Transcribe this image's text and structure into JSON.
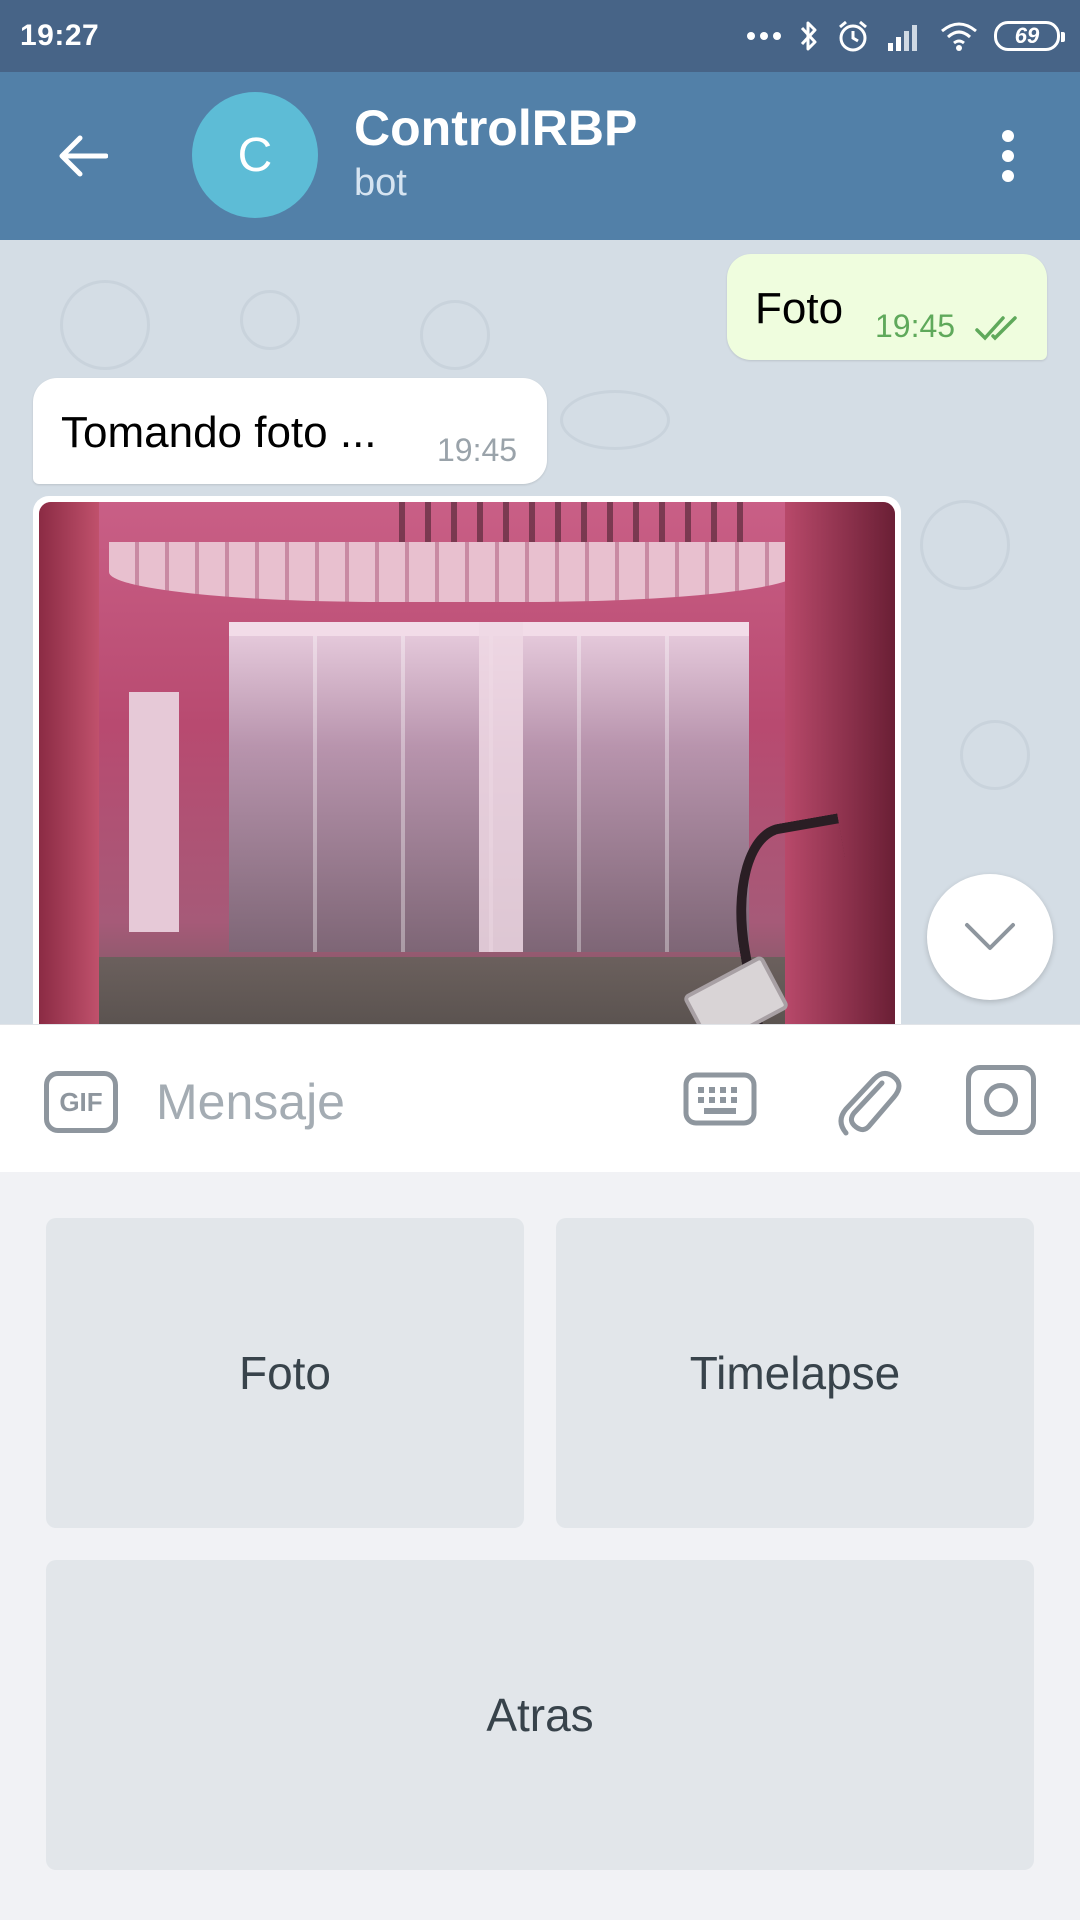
{
  "status_bar": {
    "time": "19:27",
    "battery": "69",
    "icons": [
      "more-dots-icon",
      "bluetooth-icon",
      "alarm-icon",
      "signal-icon",
      "wifi-icon",
      "battery-icon"
    ]
  },
  "header": {
    "avatar_letter": "C",
    "title": "ControlRBP",
    "subtitle": "bot",
    "colors": {
      "header": "#5280a8",
      "avatar": "#5dbcd6"
    }
  },
  "messages": [
    {
      "direction": "out",
      "text": "Foto",
      "time": "19:45",
      "status": "read"
    },
    {
      "direction": "in",
      "text": "Tomando foto ...",
      "time": "19:45"
    },
    {
      "direction": "in",
      "type": "photo"
    }
  ],
  "input": {
    "gif_label": "GIF",
    "placeholder": "Mensaje"
  },
  "bot_keyboard": {
    "buttons": [
      "Foto",
      "Timelapse",
      "Atras"
    ]
  }
}
